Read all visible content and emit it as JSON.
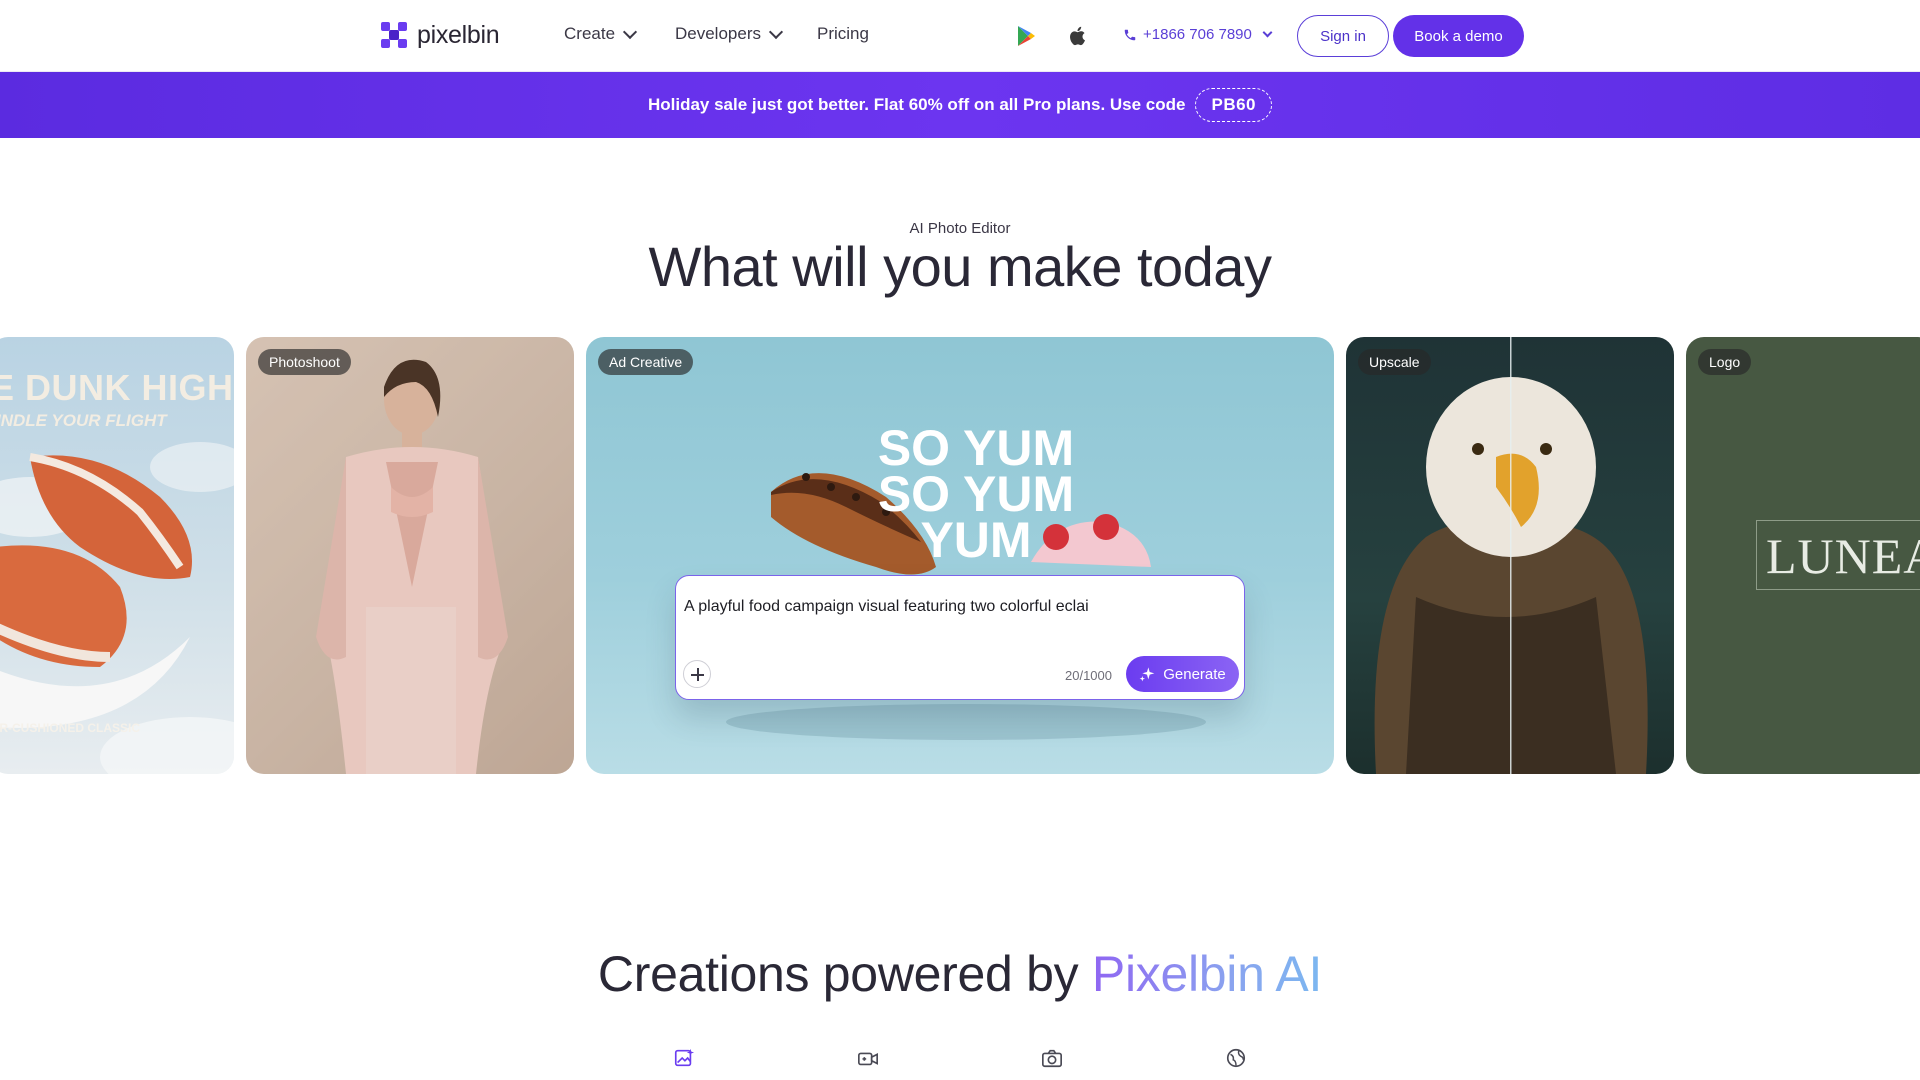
{
  "nav": {
    "brand": "pixelbin",
    "items": [
      {
        "label": "Create",
        "has_dropdown": true
      },
      {
        "label": "Developers",
        "has_dropdown": true
      },
      {
        "label": "Pricing",
        "has_dropdown": false
      }
    ],
    "store_icons": [
      "google-play-icon",
      "apple-icon"
    ],
    "phone": "+1866 706 7890",
    "signin_label": "Sign in",
    "demo_label": "Book a demo",
    "accent": "#6331e8"
  },
  "promo": {
    "text": "Holiday sale just got better. Flat 60% off on all Pro plans. Use code",
    "code": "PB60"
  },
  "hero": {
    "eyebrow": "AI Photo Editor",
    "title": "What will you make today"
  },
  "cards": [
    {
      "tag": "",
      "headline": "E DUNK HIGH",
      "subline": "INDLE YOUR FLIGHT",
      "footer": "IR-CUSHIONED CLASSIC"
    },
    {
      "tag": "Photoshoot"
    },
    {
      "tag": "Ad Creative",
      "artwork_text": [
        "SO YUM",
        "SO YUM",
        "YUM"
      ]
    },
    {
      "tag": "Upscale"
    },
    {
      "tag": "Logo",
      "artwork_text": "LUNEA"
    }
  ],
  "prompt": {
    "value": "A playful food campaign visual featuring two colorful eclai",
    "counter": "20/1000",
    "generate_label": "Generate"
  },
  "creations": {
    "title_plain": "Creations powered by ",
    "title_accent": "Pixelbin AI",
    "category_icons": [
      "image-edit-icon",
      "video-edit-icon",
      "camera-icon",
      "globe-icon"
    ]
  }
}
